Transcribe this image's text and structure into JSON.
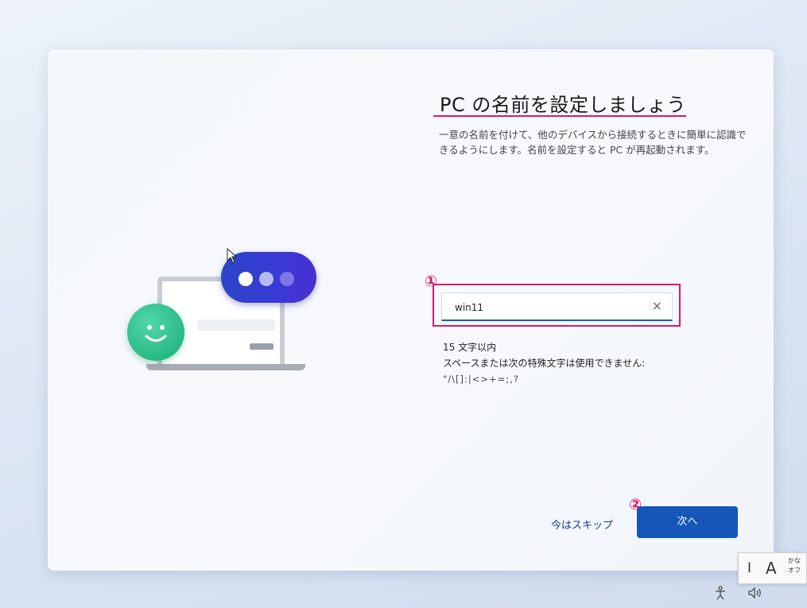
{
  "page": {
    "title": "PC の名前を設定しましょう",
    "description": "一意の名前を付けて、他のデバイスから接続するときに簡単に認識できるようにします。名前を設定すると PC が再起動されます。"
  },
  "name_field": {
    "value": "win11",
    "clear_label": "×"
  },
  "hints": {
    "length": "15 文字以内",
    "rule": "スペースまたは次の特殊文字は使用できません:",
    "chars": "\"/\\[]:|<>+=;,?"
  },
  "annotations": {
    "marker1": "①",
    "marker2": "②"
  },
  "actions": {
    "skip_label": "今はスキップ",
    "next_label": "次へ"
  },
  "ime": {
    "mode_i": "I",
    "mode_a": "A",
    "kana_line1": "かな",
    "kana_line2": "オフ"
  },
  "tray": {
    "accessibility_icon": "accessibility-icon",
    "volume_icon": "volume-icon"
  },
  "colors": {
    "accent": "#1656b8",
    "annotation": "#e0166f"
  }
}
